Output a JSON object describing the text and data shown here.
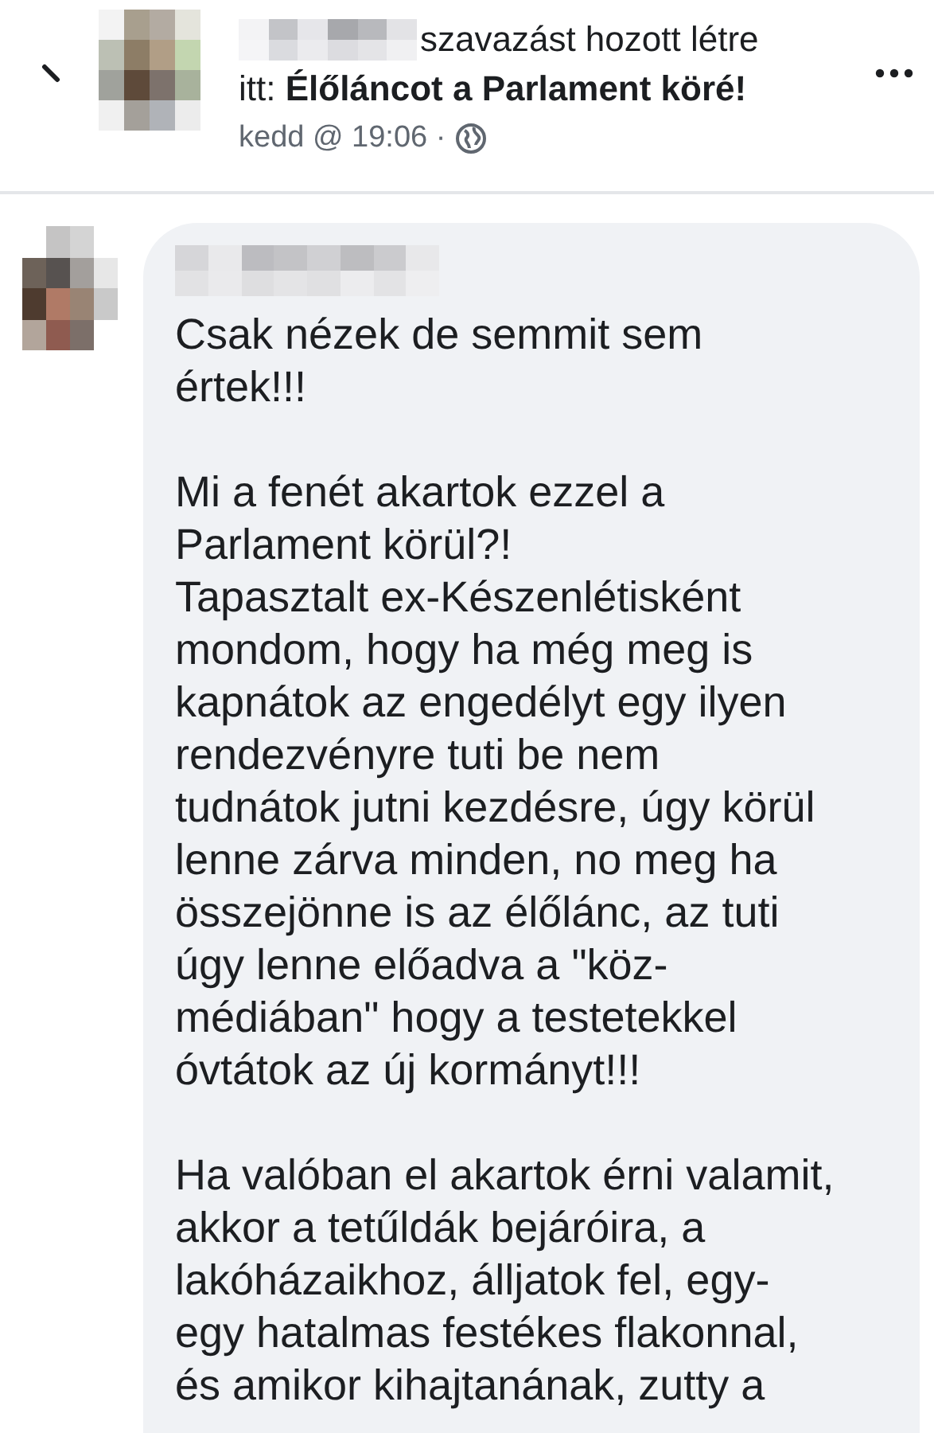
{
  "post": {
    "action_text": "szavazást hozott létre",
    "target_text": "itt: **Élőláncot a Parlament köré!**",
    "time": "kedd @ 19:06 ·"
  },
  "comment": {
    "paragraphs": [
      [
        "Csak nézek de semmit sem",
        "értek!!!"
      ],
      [
        "Mi a fenét akartok ezzel a",
        "Parlament körül?!",
        "Tapasztalt ex-Készenlétisként",
        "mondom, hogy ha még meg is",
        "kapnátok az engedélyt egy ilyen",
        "rendezvényre tuti be nem",
        "tudnátok jutni kezdésre, úgy körül",
        "lenne zárva minden, no meg ha",
        "összejönne is az élőlánc, az tuti",
        "úgy lenne előadva a \"köz-",
        "médiában\" hogy a testetekkel",
        "óvtátok az új kormányt!!!"
      ],
      [
        "Ha valóban el akartok érni valamit,",
        "akkor a tetűldák bejáróira, a",
        "lakóházaikhoz, álljatok fel, egy-",
        "egy hatalmas festékes flakonnal,",
        "és amikor kihajtanának, zutty a"
      ]
    ]
  }
}
